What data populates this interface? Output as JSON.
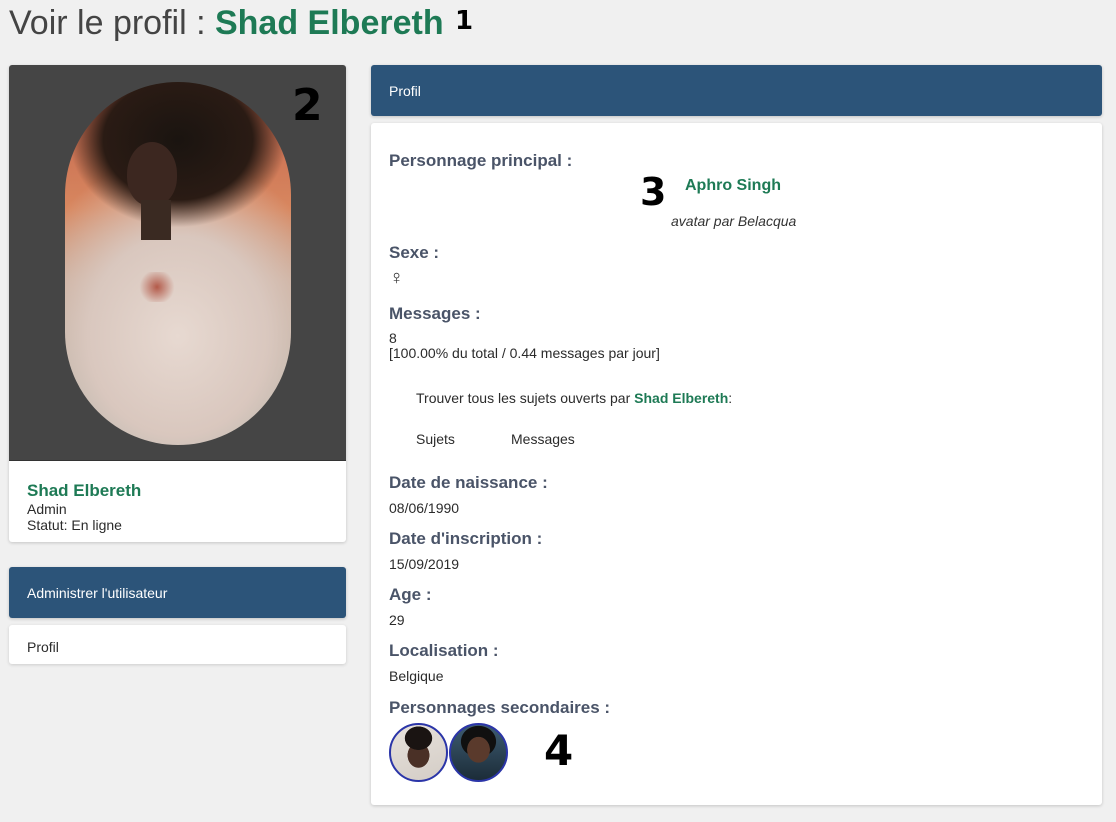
{
  "page": {
    "title_prefix": "Voir le profil : ",
    "username": "Shad Elbereth"
  },
  "annotations": [
    "1",
    "2",
    "3",
    "4"
  ],
  "user_card": {
    "name": "Shad Elbereth",
    "rank": "Admin",
    "status": "Statut: En ligne"
  },
  "admin_panel": {
    "header": "Administrer l'utilisateur",
    "link": "Profil"
  },
  "profile": {
    "header": "Profil",
    "main_char_label": "Personnage principal :",
    "main_char_name": "Aphro Singh",
    "avatar_credit": "avatar par Belacqua",
    "sex_label": "Sexe :",
    "sex_icon": "♀",
    "messages_label": "Messages :",
    "messages_count": "8",
    "messages_stats": "[100.00% du total / 0.44 messages par jour]",
    "find_topics_prefix": "Trouver tous les sujets ouverts par ",
    "find_topics_name": "Shad Elbereth",
    "find_topics_suffix": ":",
    "link_topics": "Sujets",
    "link_messages": "Messages",
    "birth_label": "Date de naissance :",
    "birth_value": "08/06/1990",
    "signup_label": "Date d'inscription :",
    "signup_value": "15/09/2019",
    "age_label": "Age :",
    "age_value": "29",
    "location_label": "Localisation :",
    "location_value": "Belgique",
    "secondary_label": "Personnages secondaires :"
  }
}
